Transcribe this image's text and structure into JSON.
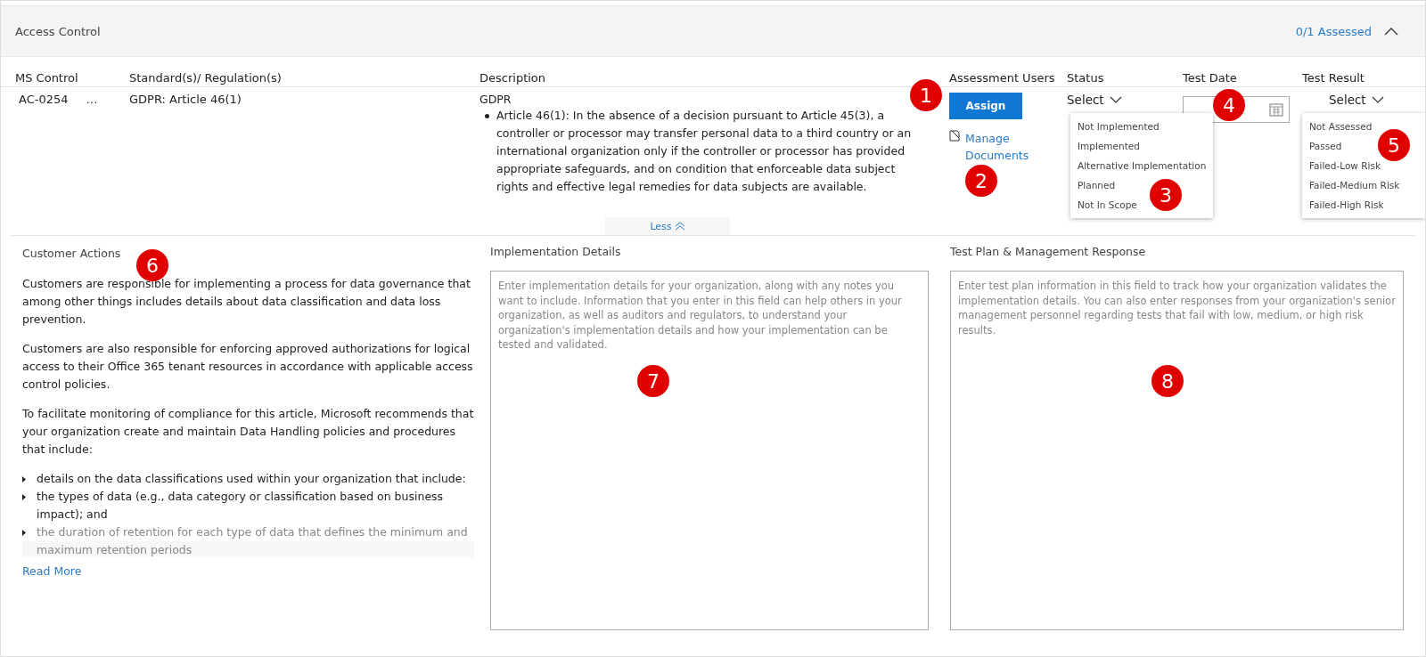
{
  "section": {
    "title": "Access Control",
    "assessed": "0/1 Assessed",
    "expanded": true
  },
  "columns": [
    "MS Control",
    "Standard(s)/ Regulation(s)",
    "Description",
    "Assessment Users",
    "Status",
    "Test Date",
    "Test Result"
  ],
  "row": {
    "control": "AC-0254",
    "more": "…",
    "standard": "GDPR: Article 46(1)",
    "description_title": "GDPR",
    "description_bullets": [
      "Article 46(1): In the absence of a decision pursuant to Article 45(3), a controller or processor may transfer personal data to a third country or an international organization only if the controller or processor has provided appropriate safeguards, and on condition that enforceable data subject rights and effective legal remedies for data subjects are available."
    ],
    "assign_button": "Assign",
    "manage_documents": "Manage Documents",
    "status_select": "Select",
    "status_options": [
      "Not Implemented",
      "Implemented",
      "Alternative Implementation",
      "Planned",
      "Not In Scope"
    ],
    "test_result_select": "Select",
    "test_result_options": [
      "Not Assessed",
      "Passed",
      "Failed-Low Risk",
      "Failed-Medium Risk",
      "Failed-High Risk"
    ],
    "less_toggle": "Less"
  },
  "customer_actions": {
    "title": "Customer Actions",
    "paragraphs": [
      "Customers are responsible for implementing a process for data governance that among other things includes details about data classification and data loss prevention.",
      "Customers are also responsible for enforcing approved authorizations for logical access to their Office 365 tenant resources in accordance with applicable access control policies.",
      "To facilitate monitoring of compliance for this article, Microsoft recommends that your organization create and maintain Data Handling policies and procedures that include:"
    ],
    "bullets": [
      "details on the data classifications used within your organization that include:",
      "the types of data (e.g., data category or classification based on business impact); and",
      "the duration of retention for each type of data that defines the minimum and maximum retention periods"
    ],
    "read_more": "Read More"
  },
  "implementation_details": {
    "title": "Implementation Details",
    "placeholder": "Enter implementation details for your organization, along with any notes you want to include. Information that you enter in this field can help others in your organization, as well as auditors and regulators, to understand your organization's implementation details and how your implementation can be tested and validated."
  },
  "test_plan": {
    "title": "Test Plan & Management Response",
    "placeholder": "Enter test plan information in this field to track how your organization validates the implementation details. You can also enter responses from your organization's senior management personnel regarding tests that fail with low, medium, or high risk results."
  },
  "callouts": [
    "1",
    "2",
    "3",
    "4",
    "5",
    "6",
    "7",
    "8"
  ]
}
